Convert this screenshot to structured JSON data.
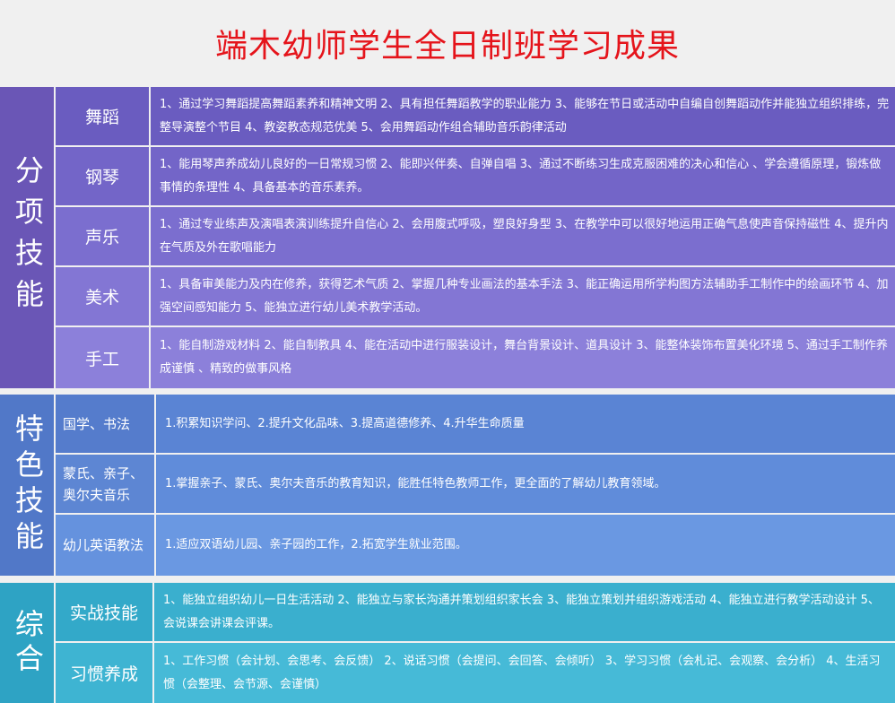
{
  "title": "端木幼师学生全日制班学习成果",
  "colors": {
    "title_red": "#e5141b",
    "section1_label": "#6a56b6",
    "section2_label": "#5178c8",
    "section3_label": "#2ea3c4"
  },
  "sections": [
    {
      "label": "分项技能",
      "rows": [
        {
          "category": "舞蹈",
          "description": "1、通过学习舞蹈提高舞蹈素养和精神文明 2、具有担任舞蹈教学的职业能力 3、能够在节日或活动中自编自创舞蹈动作并能独立组织排练，完整导演整个节目 4、教姿教态规范优美 5、会用舞蹈动作组合辅助音乐韵律活动"
        },
        {
          "category": "钢琴",
          "description": "1、能用琴声养成幼儿良好的一日常规习惯 2、能即兴伴奏、自弹自唱 3、通过不断练习生成克服困难的决心和信心 、学会遵循原理，锻炼做事情的条理性 4、具备基本的音乐素养。"
        },
        {
          "category": "声乐",
          "description": "1、通过专业练声及演唱表演训练提升自信心 2、会用腹式呼吸，塑良好身型 3、在教学中可以很好地运用正确气息使声音保持磁性 4、提升内在气质及外在歌唱能力"
        },
        {
          "category": "美术",
          "description": "1、具备审美能力及内在修养，获得艺术气质 2、掌握几种专业画法的基本手法 3、能正确运用所学构图方法辅助手工制作中的绘画环节 4、加强空间感知能力 5、能独立进行幼儿美术教学活动。"
        },
        {
          "category": "手工",
          "description": "1、能自制游戏材料 2、能自制教具 4、能在活动中进行服装设计，舞台背景设计、道具设计 3、能整体装饰布置美化环境 5、通过手工制作养成谨慎 、精致的做事风格"
        }
      ]
    },
    {
      "label": "特色技能",
      "rows": [
        {
          "category": "国学、书法",
          "description": "1.积累知识学问、2.提升文化品味、3.提高道德修养、4.升华生命质量"
        },
        {
          "category": "蒙氏、亲子、奥尔夫音乐",
          "description": "1.掌握亲子、蒙氏、奥尔夫音乐的教育知识，能胜任特色教师工作，更全面的了解幼儿教育领域。"
        },
        {
          "category": "幼儿英语教法",
          "description": "1.适应双语幼儿园、亲子园的工作，2.拓宽学生就业范围。"
        }
      ]
    },
    {
      "label": "综合",
      "rows": [
        {
          "category": "实战技能",
          "description": "1、能独立组织幼儿一日生活活动 2、能独立与家长沟通并策划组织家长会 3、能独立策划并组织游戏活动 4、能独立进行教学活动设计 5、会说课会讲课会评课。"
        },
        {
          "category": "习惯养成",
          "description": "1、工作习惯（会计划、会思考、会反馈） 2、说话习惯（会提问、会回答、会倾听） 3、学习习惯（会札记、会观察、会分析） 4、生活习惯（会整理、会节源、会谨慎）"
        }
      ]
    }
  ]
}
